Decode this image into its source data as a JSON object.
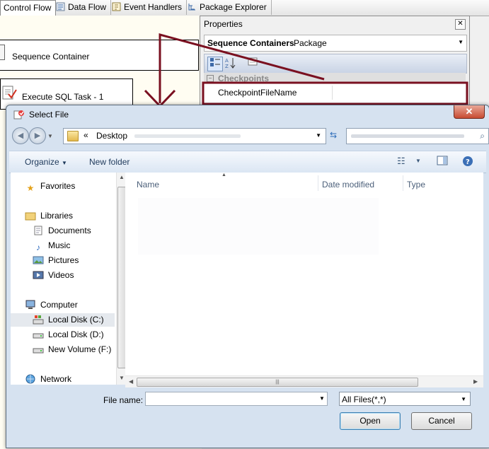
{
  "designer": {
    "tabs": [
      {
        "label": "Control Flow",
        "active": true
      },
      {
        "label": "Data Flow"
      },
      {
        "label": "Event Handlers"
      },
      {
        "label": "Package Explorer"
      }
    ],
    "tasks": {
      "sequence_container": "Sequence Container",
      "execute_sql": "Execute SQL Task - 1"
    }
  },
  "properties": {
    "title": "Properties",
    "close_glyph": "✕",
    "selected_object": "Sequence Containers",
    "selected_type": "Package",
    "category": "Checkpoints",
    "row_label": "CheckpointFileName",
    "row_value": ""
  },
  "dialog": {
    "title": "Select File",
    "location": "Desktop",
    "organize_label": "Organize",
    "new_folder_label": "New folder",
    "favorites_label": "Favorites",
    "libraries": {
      "label": "Libraries",
      "items": [
        "Documents",
        "Music",
        "Pictures",
        "Videos"
      ]
    },
    "computer": {
      "label": "Computer",
      "drives": [
        "Local Disk (C:)",
        "Local Disk (D:)",
        "New Volume (F:)"
      ]
    },
    "network_label": "Network",
    "columns": [
      "Name",
      "Date modified",
      "Type"
    ],
    "filename_label": "File name:",
    "filename_value": "",
    "filter_value": "All Files(*,*)",
    "open_label": "Open",
    "cancel_label": "Cancel"
  },
  "colors": {
    "annotation": "#7a1020",
    "dialog_frame": "#d6e2f0",
    "close_button": "#c74b32"
  }
}
